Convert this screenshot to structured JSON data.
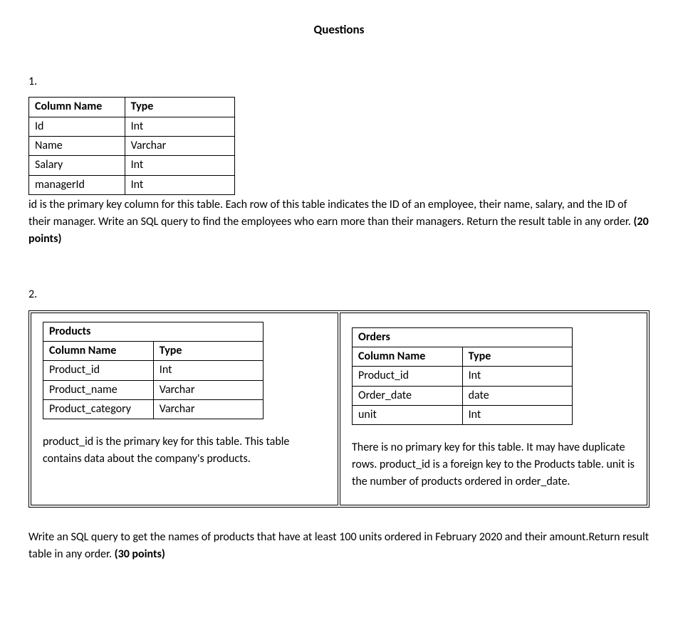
{
  "title": "Questions",
  "q1": {
    "number": "1.",
    "table": {
      "header": {
        "col1": "Column Name",
        "col2": "Type"
      },
      "rows": [
        {
          "col1": "Id",
          "col2": "Int"
        },
        {
          "col1": "Name",
          "col2": "Varchar"
        },
        {
          "col1": "Salary",
          "col2": "Int"
        },
        {
          "col1": "managerId",
          "col2": "Int"
        }
      ]
    },
    "desc": "id is the primary key column for this table. Each row of this table indicates the ID of an employee, their name, salary, and the ID of their manager. Write an SQL query to find the employees who earn more than their managers. Return the result table in any order. ",
    "points": "(20 points)"
  },
  "q2": {
    "number": "2.",
    "products": {
      "title": "Products",
      "header": {
        "col1": "Column Name",
        "col2": "Type"
      },
      "rows": [
        {
          "col1": "Product_id",
          "col2": "Int"
        },
        {
          "col1": "Product_name",
          "col2": "Varchar"
        },
        {
          "col1": "Product_category",
          "col2": "Varchar"
        }
      ],
      "desc": "product_id is the primary key for this table. This table contains data about the company's products."
    },
    "orders": {
      "title": "Orders",
      "header": {
        "col1": "Column Name",
        "col2": "Type"
      },
      "rows": [
        {
          "col1": "Product_id",
          "col2": "Int"
        },
        {
          "col1": "Order_date",
          "col2": "date"
        },
        {
          "col1": "unit",
          "col2": "Int"
        }
      ],
      "desc": "There is no primary key for this table. It may have duplicate rows. product_id is a foreign key to the Products table. unit is the number of products ordered in order_date."
    },
    "desc": "Write an SQL query to get the names of products that have at least 100 units ordered in February 2020 and their amount.Return result table in any order. ",
    "points": "(30 points)"
  }
}
